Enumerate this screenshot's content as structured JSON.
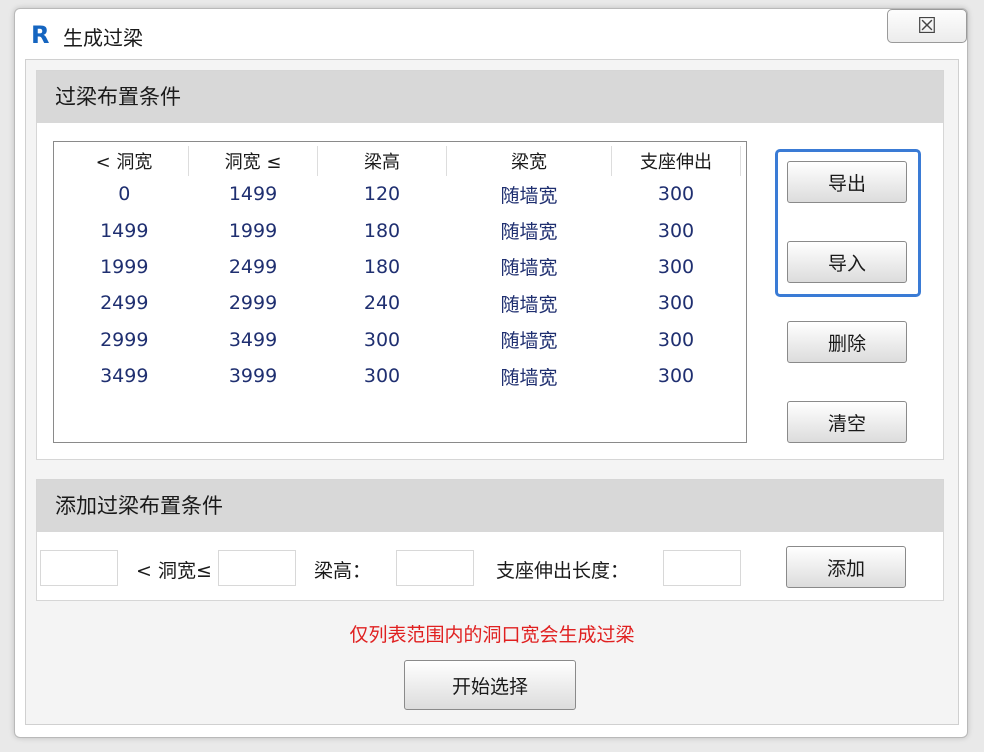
{
  "window": {
    "title": "生成过梁",
    "app_icon": "R",
    "close_label": "☒"
  },
  "group_conditions": {
    "title": "过梁布置条件",
    "columns": [
      "< 洞宽",
      "洞宽 ≤",
      "梁高",
      "梁宽",
      "支座伸出"
    ],
    "rows": [
      [
        "0",
        "1499",
        "120",
        "随墙宽",
        "300"
      ],
      [
        "1499",
        "1999",
        "180",
        "随墙宽",
        "300"
      ],
      [
        "1999",
        "2499",
        "180",
        "随墙宽",
        "300"
      ],
      [
        "2499",
        "2999",
        "240",
        "随墙宽",
        "300"
      ],
      [
        "2999",
        "3499",
        "300",
        "随墙宽",
        "300"
      ],
      [
        "3499",
        "3999",
        "300",
        "随墙宽",
        "300"
      ]
    ],
    "buttons": {
      "export": "导出",
      "import": "导入",
      "delete": "删除",
      "clear": "清空"
    }
  },
  "group_add": {
    "title": "添加过梁布置条件",
    "label_width": "< 洞宽≤",
    "label_height": "梁高：",
    "label_extension": "支座伸出长度：",
    "min_width_value": "",
    "max_width_value": "",
    "beam_height_value": "",
    "extension_value": "",
    "add_button": "添加"
  },
  "note": "仅列表范围内的洞口宽会生成过梁",
  "start_button": "开始选择",
  "colors": {
    "accent": "#3a7bd5",
    "note": "#e02020",
    "cell_text": "#1f2f70"
  }
}
